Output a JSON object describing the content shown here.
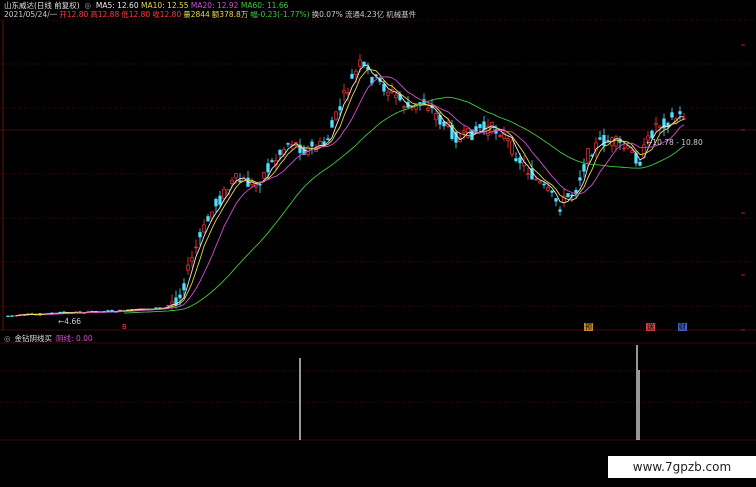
{
  "header": {
    "title": "山东威达(日线 前复权)",
    "ma5": "MA5: 12.60",
    "ma10": "MA10: 12.55",
    "ma20": "MA20: 12.92",
    "ma60": "MA60: 11.66"
  },
  "info": {
    "date": "2021/05/24/一",
    "open": "开12.80",
    "high": "高12.88",
    "low": "低12.80",
    "close": "收12.80",
    "volume": "量2844",
    "amount": "额378.8万",
    "change": "幅-0.23(-1.77%)",
    "turnover": "换0.07%",
    "circ": "流通4.23亿",
    "sector": "机械基件"
  },
  "price_labels": {
    "low_mark": "4.66",
    "range_mark": "10.78 - 10.80"
  },
  "event_markers": [
    "B",
    "预",
    "送",
    "财"
  ],
  "indicator": {
    "title": "金钻阴线买",
    "line_label": "阴线: 0.00"
  },
  "watermark": "www.7gpzb.com",
  "colors": {
    "up": "#ff3a3a",
    "down": "#4fe0ff",
    "ma5": "#e8e8e8",
    "ma10": "#e6d84a",
    "ma20": "#d050d0",
    "ma60": "#40c840",
    "grid": "#8a1010"
  }
}
